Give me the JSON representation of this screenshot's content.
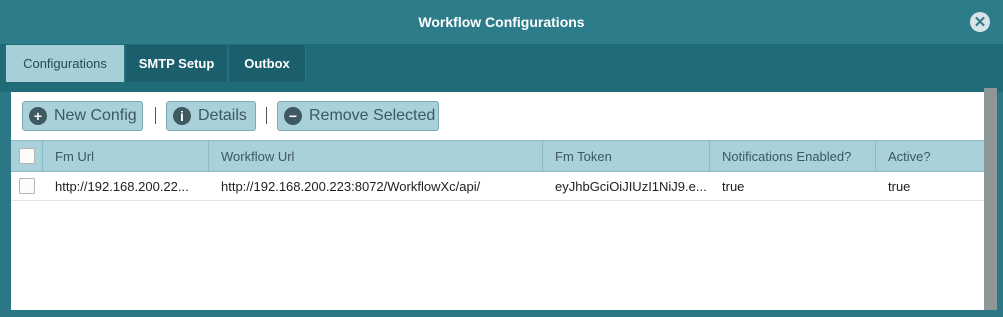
{
  "window": {
    "title": "Workflow Configurations",
    "close_icon": "close-icon"
  },
  "tabs": [
    {
      "label": "Configurations",
      "active": true
    },
    {
      "label": "SMTP Setup",
      "active": false
    },
    {
      "label": "Outbox",
      "active": false
    }
  ],
  "toolbar": {
    "new_config": {
      "label": "New Config",
      "icon": "plus-circle-icon",
      "glyph": "+"
    },
    "details": {
      "label": "Details",
      "icon": "info-circle-icon",
      "glyph": "i"
    },
    "remove_selected": {
      "label": "Remove Selected",
      "icon": "minus-circle-icon",
      "glyph": "−"
    }
  },
  "grid": {
    "columns": [
      "Fm Url",
      "Workflow Url",
      "Fm Token",
      "Notifications Enabled?",
      "Active?"
    ],
    "rows": [
      {
        "fm_url": "http://192.168.200.22...",
        "workflow_url": "http://192.168.200.223:8072/WorkflowXc/api/",
        "fm_token": "eyJhbGciOiJIUzI1NiJ9.e...",
        "notifications_enabled": "true",
        "active": "true"
      }
    ]
  },
  "colors": {
    "title_bg": "#2d7c8a",
    "tab_active_bg": "#a7cfd8",
    "tab_bg": "#1a5f6b",
    "header_bg": "#a9d1da"
  }
}
